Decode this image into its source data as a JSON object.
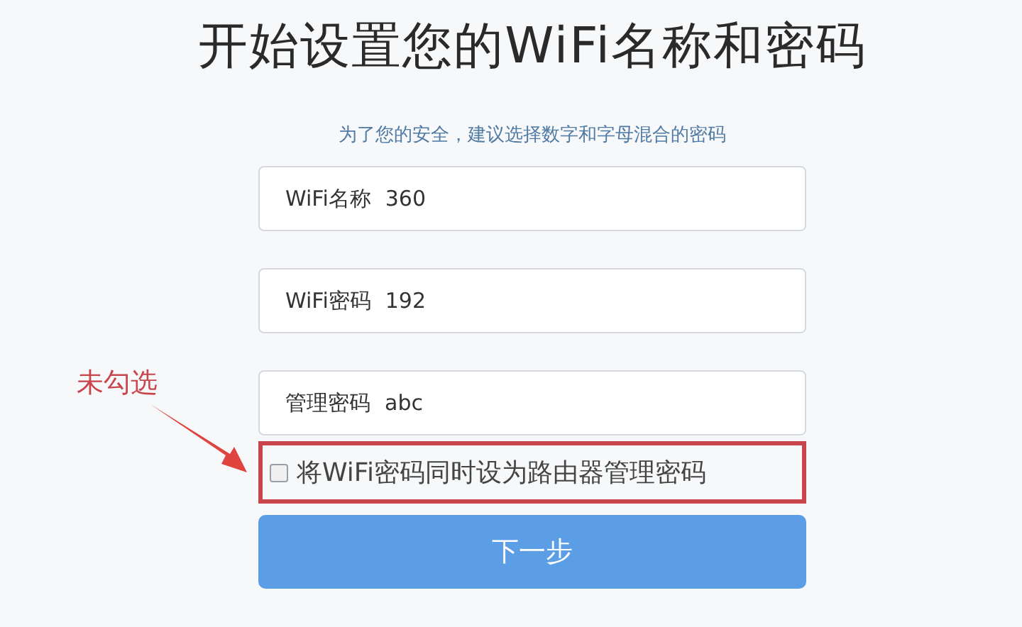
{
  "title": "开始设置您的WiFi名称和密码",
  "subtitle": "为了您的安全，建议选择数字和字母混合的密码",
  "fields": [
    {
      "label": "WiFi名称",
      "value": "360"
    },
    {
      "label": "WiFi密码",
      "value": "192"
    },
    {
      "label": "管理密码",
      "value": "abc"
    }
  ],
  "same_password_option": {
    "label": "将WiFi密码同时设为路由器管理密码",
    "checked": false,
    "highlighted": true
  },
  "next_button": "下一步",
  "annotation": {
    "label": "未勾选"
  }
}
